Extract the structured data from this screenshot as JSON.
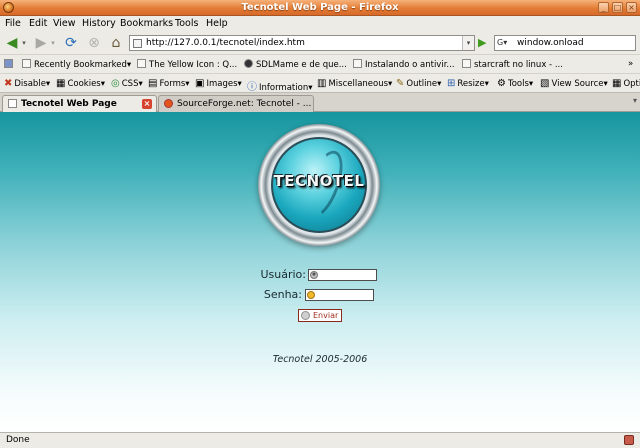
{
  "window": {
    "title": "Tecnotel Web Page - Firefox"
  },
  "menu": [
    "File",
    "Edit",
    "View",
    "History",
    "Bookmarks",
    "Tools",
    "Help"
  ],
  "navigation": {
    "url": "http://127.0.0.1/tecnotel/index.htm",
    "search_value": "window.onload"
  },
  "bookmarks": [
    "Recently Bookmarked▾",
    "The Yellow Icon : Q...",
    "SDLMame e de que...",
    "Instalando o antivir...",
    "starcraft no linux - ..."
  ],
  "devtools": [
    "Disable▾",
    "Cookies▾",
    "CSS▾",
    "Forms▾",
    "Images▾",
    "Information▾",
    "Miscellaneous▾",
    "Outline▾",
    "Resize▾",
    "Tools▾",
    "View Source▾",
    "Opti"
  ],
  "tabs": [
    {
      "label": "Tecnotel Web Page",
      "active": true
    },
    {
      "label": "SourceForge.net: Tecnotel - ...",
      "active": false
    }
  ],
  "page": {
    "logo_text": "TECNOTEL",
    "usuario_label": "Usuário:",
    "senha_label": "Senha:",
    "submit_label": "Enviar",
    "footer": "Tecnotel 2005-2006"
  },
  "status": {
    "text": "Done"
  }
}
